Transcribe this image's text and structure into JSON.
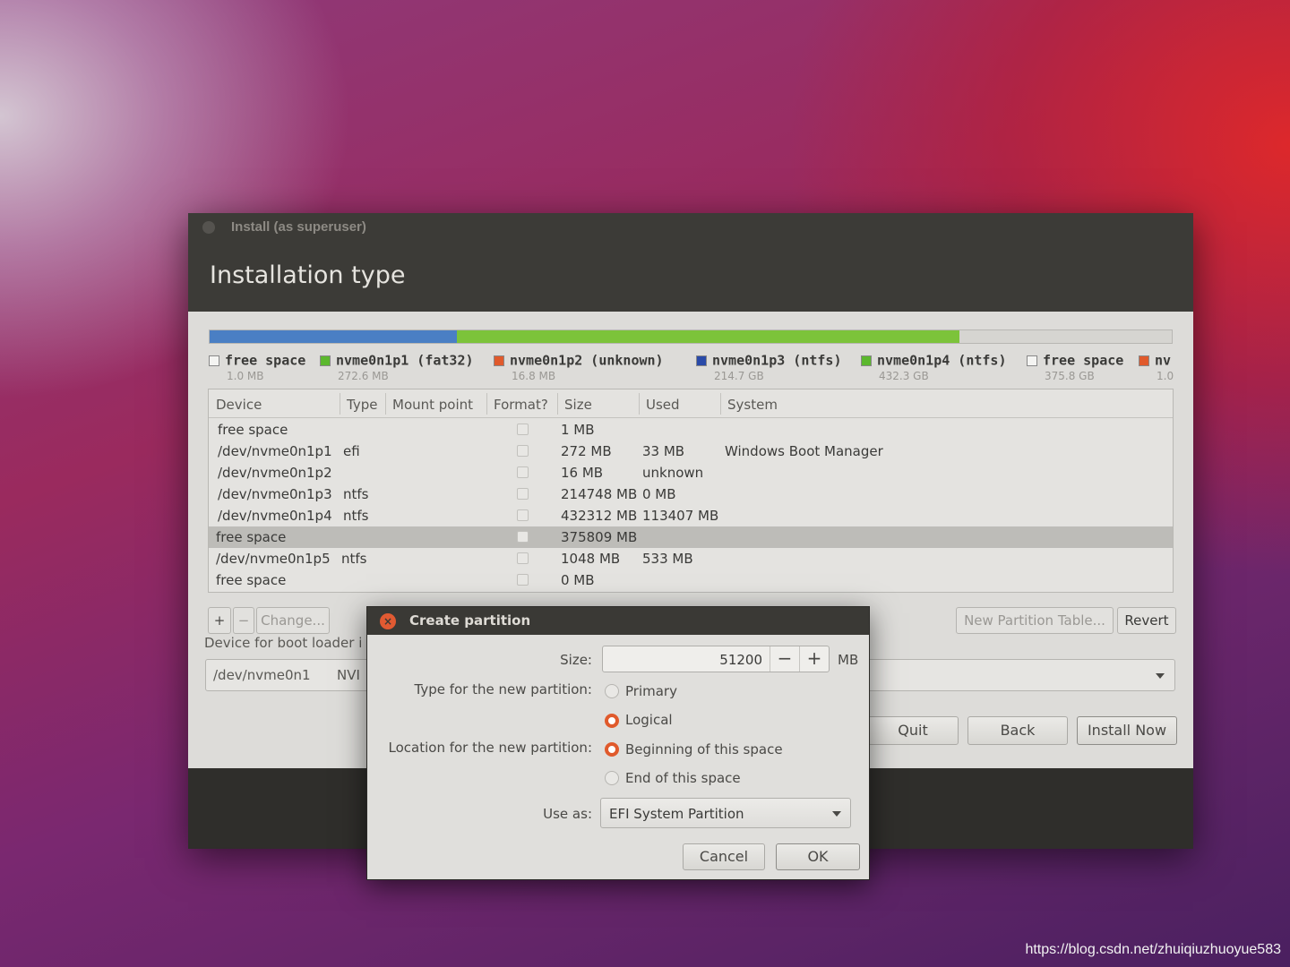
{
  "window": {
    "title": "Install (as superuser)",
    "heading": "Installation type"
  },
  "partition_bar": {
    "segments": [
      {
        "name": "free space",
        "color": "#eeeeec",
        "fraction": 0.0
      },
      {
        "name": "nvme0n1p1",
        "color": "#4a7fc4",
        "fraction": 0.256
      },
      {
        "name": "nvme0n1p2",
        "color": "#e05a2c",
        "fraction": 0.0
      },
      {
        "name": "nvme0n1p3",
        "color": "#7cc33a",
        "fraction": 0.521
      },
      {
        "name": "free space",
        "color": "#d9d8d4",
        "fraction": 0.223
      }
    ]
  },
  "legend": [
    {
      "label": "free space",
      "size": "1.0 MB",
      "color": "#f4f4f2"
    },
    {
      "label": "nvme0n1p1 (fat32)",
      "size": "272.6 MB",
      "color": "#5cb82e"
    },
    {
      "label": "nvme0n1p2 (unknown)",
      "size": "16.8 MB",
      "color": "#e05a2c"
    },
    {
      "label": "nvme0n1p3 (ntfs)",
      "size": "214.7 GB",
      "color": "#2a4aa8"
    },
    {
      "label": "nvme0n1p4 (ntfs)",
      "size": "432.3 GB",
      "color": "#5cb82e"
    },
    {
      "label": "free space",
      "size": "375.8 GB",
      "color": "#f4f4f2"
    },
    {
      "label": "nv",
      "size": "1.0",
      "color": "#e05a2c"
    }
  ],
  "table": {
    "headers": [
      "Device",
      "Type",
      "Mount point",
      "Format?",
      "Size",
      "Used",
      "System"
    ],
    "rows": [
      {
        "device": "free space",
        "type": "",
        "size": "1 MB",
        "used": "",
        "system": ""
      },
      {
        "device": "/dev/nvme0n1p1",
        "type": "efi",
        "size": "272 MB",
        "used": "33 MB",
        "system": "Windows Boot Manager"
      },
      {
        "device": "/dev/nvme0n1p2",
        "type": "",
        "size": "16 MB",
        "used": "unknown",
        "system": ""
      },
      {
        "device": "/dev/nvme0n1p3",
        "type": "ntfs",
        "size": "214748 MB",
        "used": "0 MB",
        "system": ""
      },
      {
        "device": "/dev/nvme0n1p4",
        "type": "ntfs",
        "size": "432312 MB",
        "used": "113407 MB",
        "system": ""
      },
      {
        "device": "free space",
        "type": "",
        "size": "375809 MB",
        "used": "",
        "system": ""
      },
      {
        "device": "/dev/nvme0n1p5",
        "type": "ntfs",
        "size": "1048 MB",
        "used": "533 MB",
        "system": ""
      },
      {
        "device": "free space",
        "type": "",
        "size": "0 MB",
        "used": "",
        "system": ""
      }
    ],
    "selected_index": 5
  },
  "toolbar": {
    "add": "+",
    "remove": "−",
    "change": "Change...",
    "new_table": "New Partition Table...",
    "revert": "Revert"
  },
  "bootloader": {
    "label": "Device for boot loader i",
    "device": "/dev/nvme0n1",
    "model": "NVI"
  },
  "nav": {
    "quit": "Quit",
    "back": "Back",
    "install": "Install Now"
  },
  "dialog": {
    "title": "Create partition",
    "close_glyph": "×",
    "size_label": "Size:",
    "size_value": "51200",
    "minus": "−",
    "plus": "+",
    "size_unit": "MB",
    "type_label": "Type for the new partition:",
    "type_primary": "Primary",
    "type_logical": "Logical",
    "location_label": "Location for the new partition:",
    "loc_begin": "Beginning of this space",
    "loc_end": "End of this space",
    "use_as_label": "Use as:",
    "use_as_value": "EFI System Partition",
    "cancel": "Cancel",
    "ok": "OK"
  },
  "watermark": "https://blog.csdn.net/zhuiqiuzhuoyue583"
}
